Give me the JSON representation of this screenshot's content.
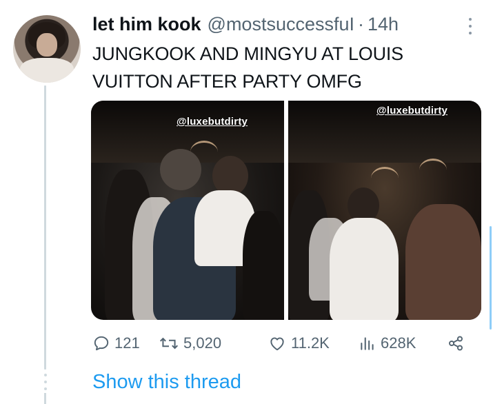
{
  "tweet": {
    "author_name": "let him kook",
    "author_handle": "@mostsuccessfuI",
    "separator": "·",
    "timestamp": "14h",
    "text": "JUNGKOOK AND MINGYU AT LOUIS\nVUITTON AFTER PARTY OMFG",
    "media": [
      {
        "watermark": "@luxebutdirty"
      },
      {
        "watermark": "@luxebutdirty"
      }
    ],
    "stats": {
      "replies": "121",
      "retweets": "5,020",
      "likes": "11.2K",
      "views": "628K"
    },
    "icons": [
      "reply-icon",
      "retweet-icon",
      "like-icon",
      "views-icon",
      "share-icon",
      "more-icon"
    ]
  },
  "show_thread_label": "Show this thread",
  "colors": {
    "link": "#1d9bf0",
    "secondary_text": "#536471",
    "primary_text": "#0f1419",
    "thread_line": "#cfd9de"
  }
}
